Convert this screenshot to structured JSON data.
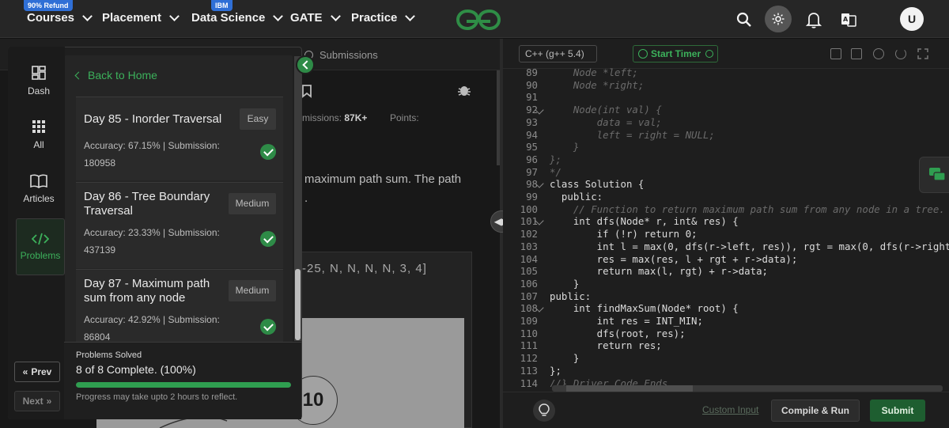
{
  "navbar": {
    "items": [
      {
        "label": "Courses",
        "badge": "90% Refund"
      },
      {
        "label": "Placement"
      },
      {
        "label": "Data Science",
        "badge": "IBM"
      },
      {
        "label": "GATE"
      },
      {
        "label": "Practice"
      }
    ],
    "avatar_initial": "U",
    "icons": [
      "search-icon",
      "theme-toggle-icon",
      "bell-icon",
      "translate-icon"
    ]
  },
  "problem": {
    "tab_submissions": "Submissions",
    "submissions_label": "missions:",
    "submissions_value": "87K+",
    "points_label": "Points:",
    "statement_line1": "maximum path sum. The path",
    "statement_line2": ".",
    "example_input": "-25, N, N, N, N, 3, 4]",
    "tree_node_value": "10"
  },
  "drawer": {
    "rail": [
      {
        "label": "Dash",
        "icon": "dashboard-icon"
      },
      {
        "label": "All",
        "icon": "grid-icon"
      },
      {
        "label": "Articles",
        "icon": "book-icon"
      },
      {
        "label": "Problems",
        "icon": "code-icon",
        "active": true
      }
    ],
    "prev_label": "Prev",
    "next_label": "Next",
    "back_home": "Back to Home",
    "days": [
      {
        "title": "Day 85 - Inorder Traversal",
        "difficulty": "Easy",
        "accuracy_line": "Accuracy: 67.15% | Submission:",
        "submission_count": "180958"
      },
      {
        "title_line1": "Day 86 - Tree Boundary",
        "title_line2": "Traversal",
        "difficulty": "Medium",
        "accuracy_line": "Accuracy: 23.33% | Submission:",
        "submission_count": "437139"
      },
      {
        "title_line1": "Day 87 - Maximum path",
        "title_line2": "sum from any node",
        "difficulty": "Medium",
        "accuracy_line": "Accuracy: 42.92% | Submission:",
        "submission_count": "86804"
      }
    ],
    "progress": {
      "label": "Problems Solved",
      "value": "8 of 8 Complete. (100%)",
      "fraction": 1.0,
      "note": "Progress may take upto 2 hours to reflect."
    }
  },
  "editor": {
    "language": "C++ (g++ 5.4)",
    "timer_label": "Start Timer",
    "code_lines": [
      {
        "n": "89",
        "text": "    Node *left;",
        "cls": "cm"
      },
      {
        "n": "90",
        "text": "    Node *right;",
        "cls": "cm"
      },
      {
        "n": "91",
        "text": "",
        "cls": "cm"
      },
      {
        "n": "92",
        "text": "    Node(int val) {",
        "cls": "cm"
      },
      {
        "n": "93",
        "text": "        data = val;",
        "cls": "cm"
      },
      {
        "n": "94",
        "text": "        left = right = NULL;",
        "cls": "cm"
      },
      {
        "n": "95",
        "text": "    }",
        "cls": "cm"
      },
      {
        "n": "96",
        "text": "};",
        "cls": "cm"
      },
      {
        "n": "97",
        "text": "*/",
        "cls": "cm"
      },
      {
        "n": "98",
        "text": "class Solution {",
        "cls": "tx"
      },
      {
        "n": "99",
        "text": "  public:",
        "cls": "tx"
      },
      {
        "n": "100",
        "text": "    // Function to return maximum path sum from any node in a tree.",
        "cls": "cm"
      },
      {
        "n": "101",
        "text": "    int dfs(Node* r, int& res) {",
        "cls": "tx"
      },
      {
        "n": "102",
        "text": "        if (!r) return 0;",
        "cls": "tx"
      },
      {
        "n": "103",
        "text": "        int l = max(0, dfs(r->left, res)), rgt = max(0, dfs(r->right",
        "cls": "tx"
      },
      {
        "n": "104",
        "text": "        res = max(res, l + rgt + r->data);",
        "cls": "tx"
      },
      {
        "n": "105",
        "text": "        return max(l, rgt) + r->data;",
        "cls": "tx"
      },
      {
        "n": "106",
        "text": "    }",
        "cls": "tx"
      },
      {
        "n": "107",
        "text": "public:",
        "cls": "tx"
      },
      {
        "n": "108",
        "text": "    int findMaxSum(Node* root) {",
        "cls": "tx"
      },
      {
        "n": "109",
        "text": "        int res = INT_MIN;",
        "cls": "tx"
      },
      {
        "n": "110",
        "text": "        dfs(root, res);",
        "cls": "tx"
      },
      {
        "n": "111",
        "text": "        return res;",
        "cls": "tx"
      },
      {
        "n": "112",
        "text": "    }",
        "cls": "tx"
      },
      {
        "n": "113",
        "text": "};",
        "cls": "tx"
      },
      {
        "n": "114",
        "text": "//} Driver Code Ends",
        "cls": "cm"
      }
    ],
    "custom_input_label": "Custom Input",
    "compile_label": "Compile & Run",
    "submit_label": "Submit"
  },
  "colors": {
    "accent_green": "#2f9e50",
    "brand_green": "#2f8d46",
    "badge_blue": "#2f6fd6"
  }
}
